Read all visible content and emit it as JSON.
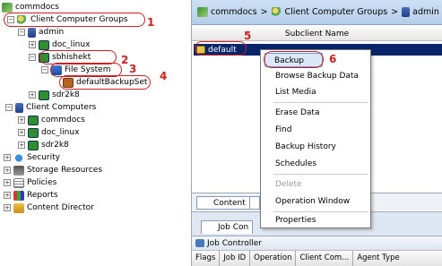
{
  "tree": {
    "items": [
      {
        "label": "commdocs"
      },
      {
        "label": "Client Computer Groups"
      },
      {
        "label": "admin"
      },
      {
        "label": "doc_linux"
      },
      {
        "label": "sbhishekt"
      },
      {
        "label": "File System"
      },
      {
        "label": "defaultBackupSet"
      },
      {
        "label": "sdr2k8"
      },
      {
        "label": "Client Computers"
      },
      {
        "label": "commdocs"
      },
      {
        "label": "doc_linux"
      },
      {
        "label": "sdr2k8"
      },
      {
        "label": "Security"
      },
      {
        "label": "Storage Resources"
      },
      {
        "label": "Policies"
      },
      {
        "label": "Reports"
      },
      {
        "label": "Content Director"
      }
    ],
    "toggle_plus": "+",
    "toggle_minus": "−"
  },
  "callouts": [
    "1",
    "2",
    "3",
    "4",
    "5",
    "6"
  ],
  "breadcrumb": {
    "items": [
      "commdocs",
      "Client Computer Groups",
      "admin"
    ],
    "separator": ">"
  },
  "list": {
    "column_header": "Subclient Name",
    "selected_row": "default"
  },
  "context_menu": {
    "items": [
      {
        "label": "Backup"
      },
      {
        "label": "Browse Backup Data"
      },
      {
        "label": "List Media"
      },
      {
        "label": "Erase Data"
      },
      {
        "label": "Find"
      },
      {
        "label": "Backup History"
      },
      {
        "label": "Schedules"
      },
      {
        "label": "Delete"
      },
      {
        "label": "Operation Window"
      },
      {
        "label": "Properties"
      }
    ]
  },
  "bottom": {
    "content_tab": "Content",
    "job_tab": "Job Con",
    "job_controller_title": "Job Controller",
    "columns": [
      "Flags",
      "Job ID",
      "Operation",
      "Client Com...",
      "Agent Type"
    ]
  },
  "colors": {
    "selection_dark": "#0a246a",
    "callout_red": "#d02020",
    "menu_highlight": "#dbe8fa"
  }
}
